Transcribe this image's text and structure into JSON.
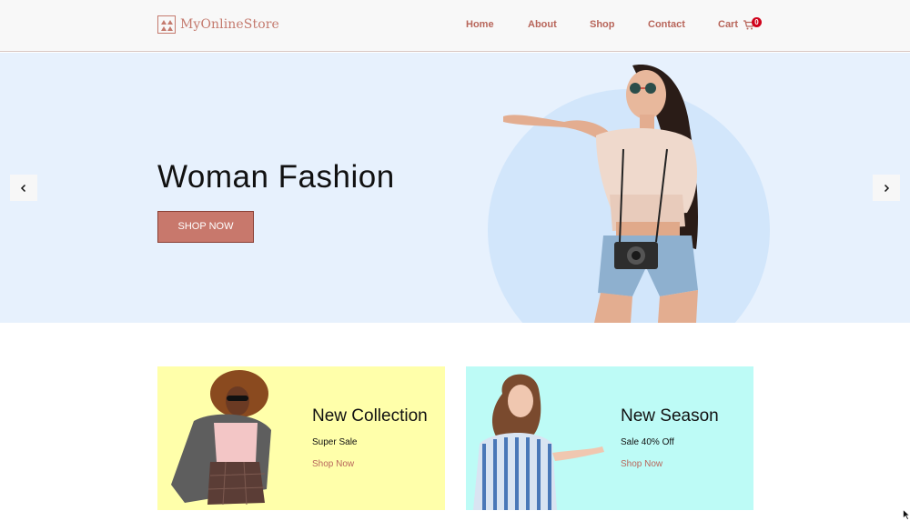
{
  "header": {
    "logo_text": "MyOnlineStore",
    "nav": {
      "home": "Home",
      "about": "About",
      "shop": "Shop",
      "contact": "Contact",
      "cart": "Cart"
    },
    "cart_count": "0",
    "cart_icon": "cart-icon"
  },
  "hero": {
    "title": "Woman Fashion",
    "button_label": "SHOP NOW",
    "prev_icon": "chevron-left-icon",
    "next_icon": "chevron-right-icon"
  },
  "cards": [
    {
      "title": "New Collection",
      "subtitle": "Super Sale",
      "link": "Shop Now"
    },
    {
      "title": "New Season",
      "subtitle": "Sale 40% Off",
      "link": "Shop Now"
    }
  ],
  "colors": {
    "accent": "#c8786c",
    "nav_text": "#b8665b",
    "hero_bg": "#e7f1fd",
    "card_yellow": "#ffffaa",
    "card_cyan": "#bdfbf6",
    "badge": "#d0021b"
  }
}
